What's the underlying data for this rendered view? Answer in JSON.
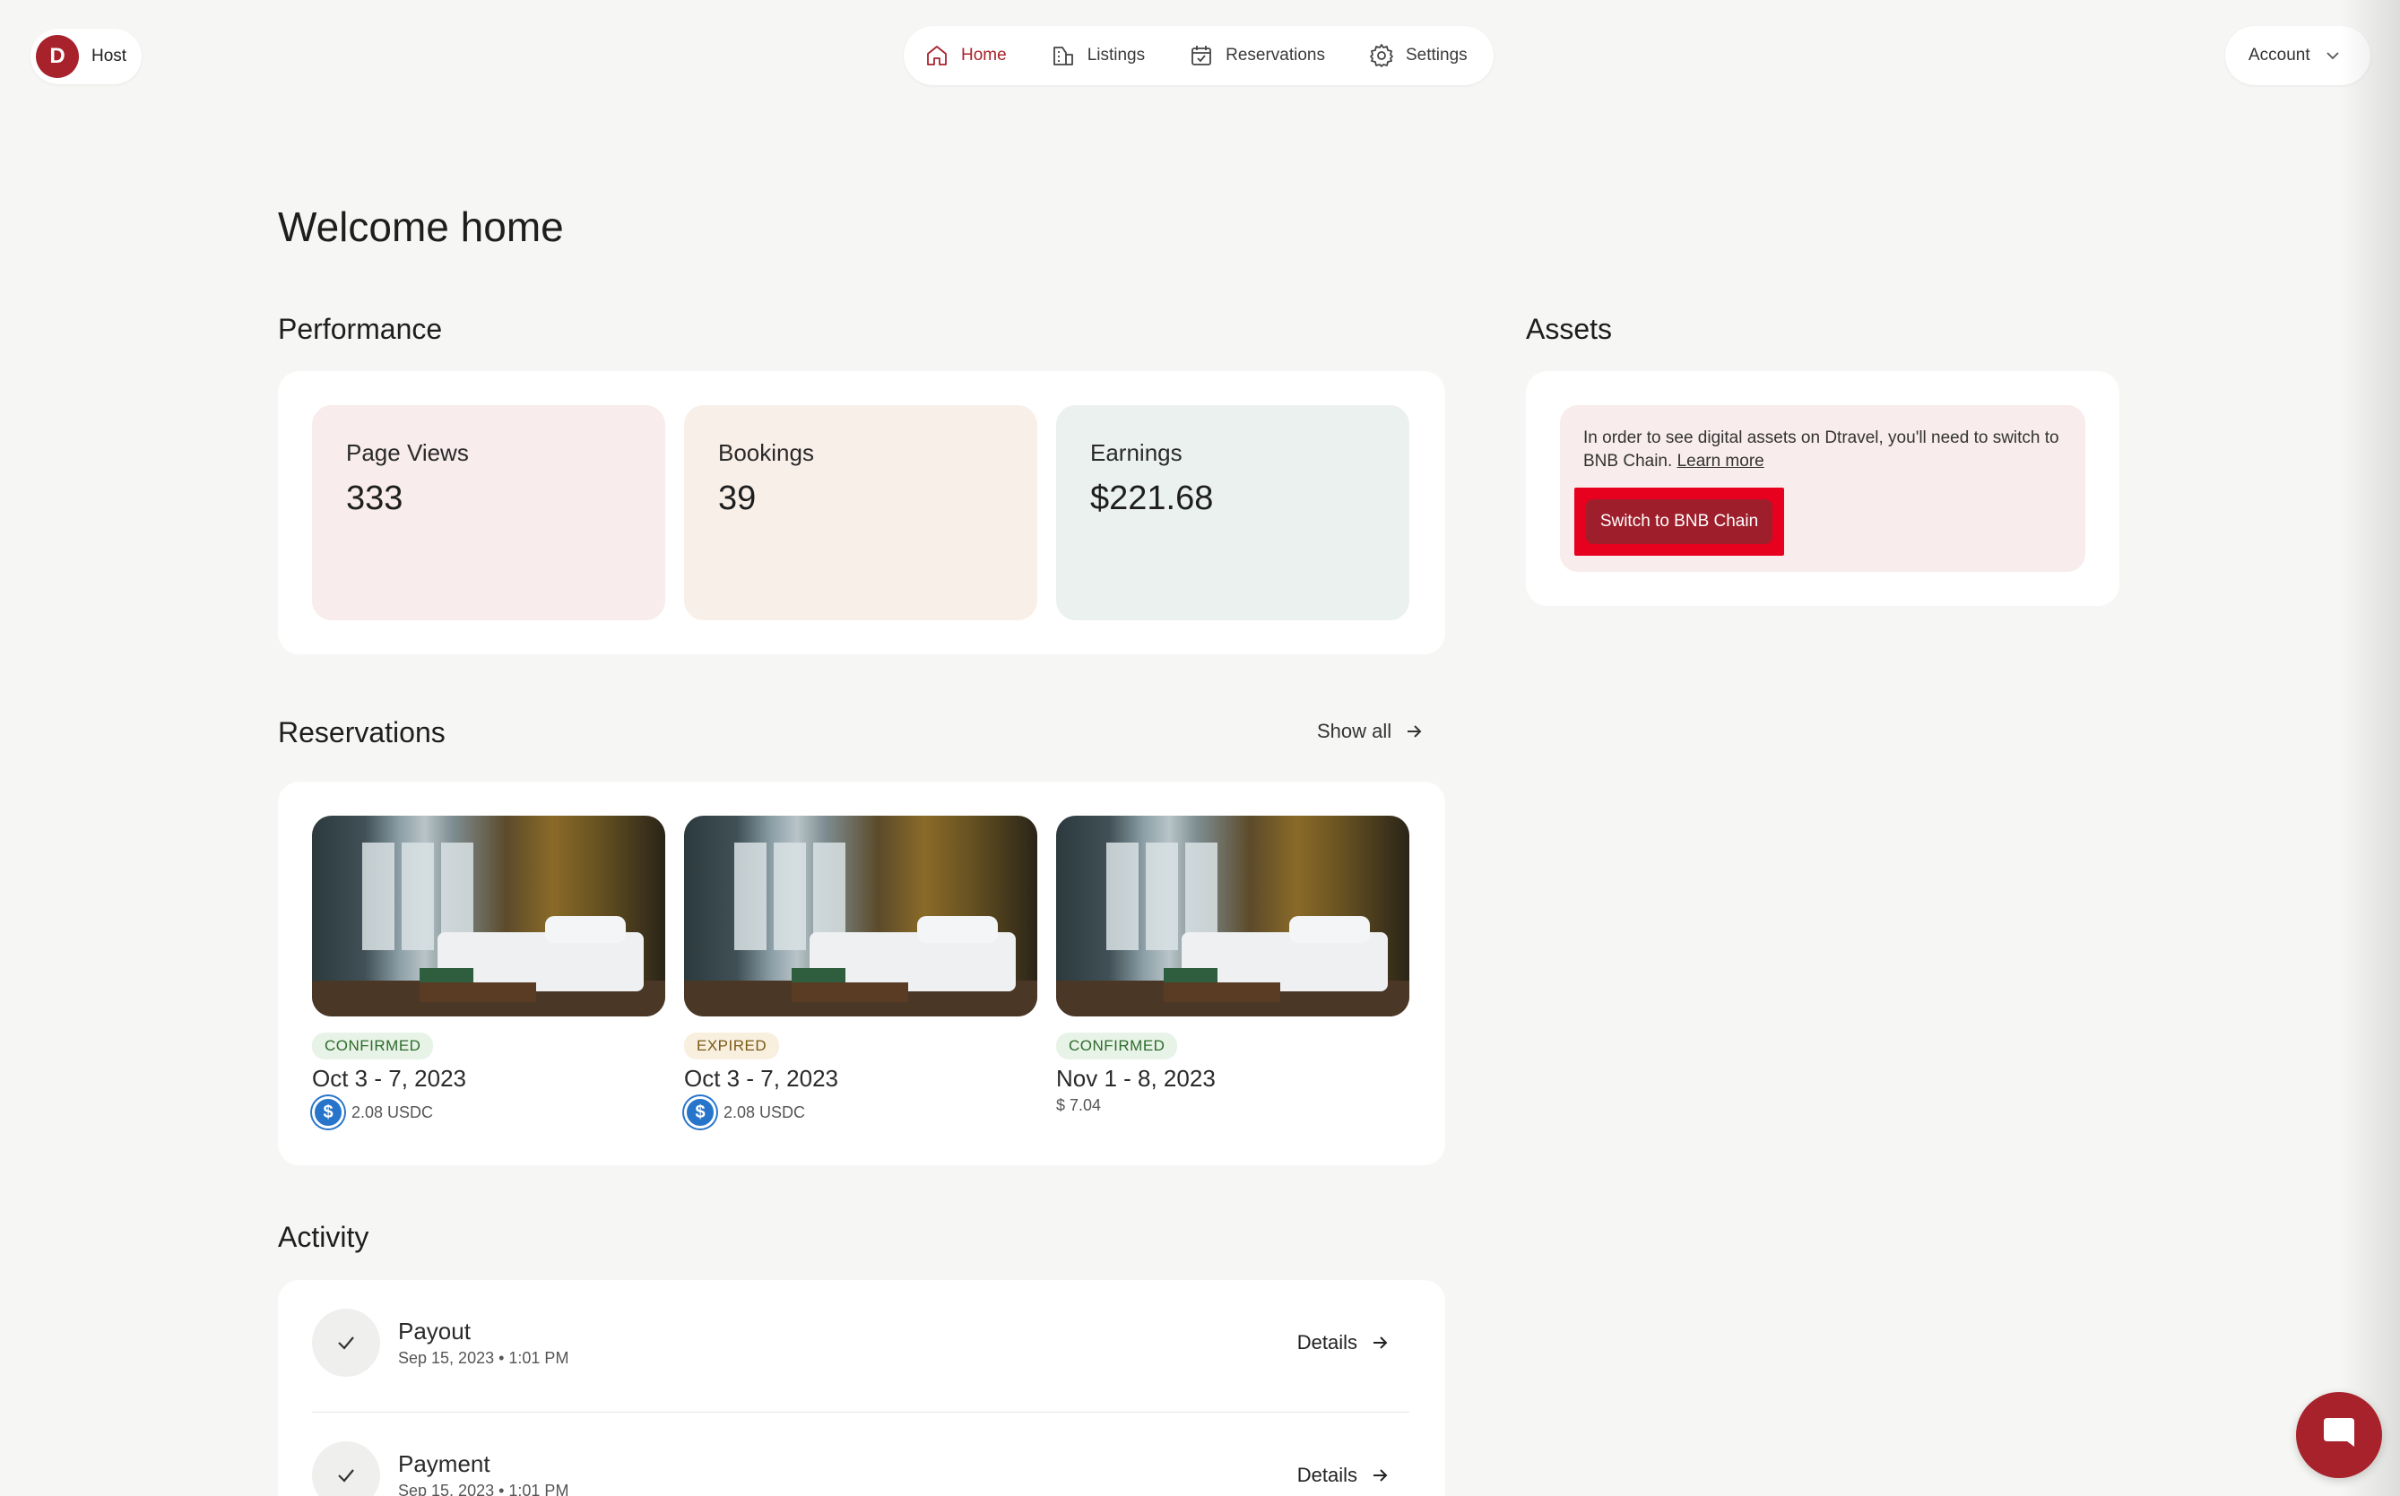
{
  "brand": {
    "logo_letter": "D",
    "label": "Host"
  },
  "nav": {
    "items": [
      {
        "label": "Home",
        "icon": "home-icon",
        "active": true
      },
      {
        "label": "Listings",
        "icon": "building-icon",
        "active": false
      },
      {
        "label": "Reservations",
        "icon": "calendar-icon",
        "active": false
      },
      {
        "label": "Settings",
        "icon": "gear-icon",
        "active": false
      }
    ]
  },
  "account": {
    "label": "Account",
    "icon": "chevron-down-icon"
  },
  "page": {
    "title": "Welcome home"
  },
  "performance": {
    "title": "Performance",
    "stats": [
      {
        "label": "Page Views",
        "value": "333",
        "bg": "#f8ecec"
      },
      {
        "label": "Bookings",
        "value": "39",
        "bg": "#f9efe9"
      },
      {
        "label": "Earnings",
        "value": "$221.68",
        "bg": "#eaf1ee"
      }
    ]
  },
  "assets": {
    "title": "Assets",
    "notice_text": "In order to see digital assets on Dtravel, you'll need to switch to BNB Chain.",
    "learn_more": "Learn more",
    "button_label": "Switch to BNB Chain"
  },
  "reservations": {
    "title": "Reservations",
    "show_all": "Show all",
    "items": [
      {
        "status": "CONFIRMED",
        "dates": "Oct 3 - 7, 2023",
        "amount": "2.08 USDC",
        "currency_icon": "usdc-icon"
      },
      {
        "status": "EXPIRED",
        "dates": "Oct 3 - 7, 2023",
        "amount": "2.08 USDC",
        "currency_icon": "usdc-icon"
      },
      {
        "status": "CONFIRMED",
        "dates": "Nov 1 - 8, 2023",
        "amount": "$ 7.04",
        "currency_icon": ""
      }
    ]
  },
  "activity": {
    "title": "Activity",
    "items": [
      {
        "title": "Payout",
        "time": "Sep 15, 2023 • 1:01 PM",
        "details": "Details"
      },
      {
        "title": "Payment",
        "time": "Sep 15, 2023 • 1:01 PM",
        "details": "Details"
      }
    ]
  },
  "colors": {
    "accent": "#a8222b",
    "highlight": "#e8001f",
    "usdc": "#2775ca"
  }
}
